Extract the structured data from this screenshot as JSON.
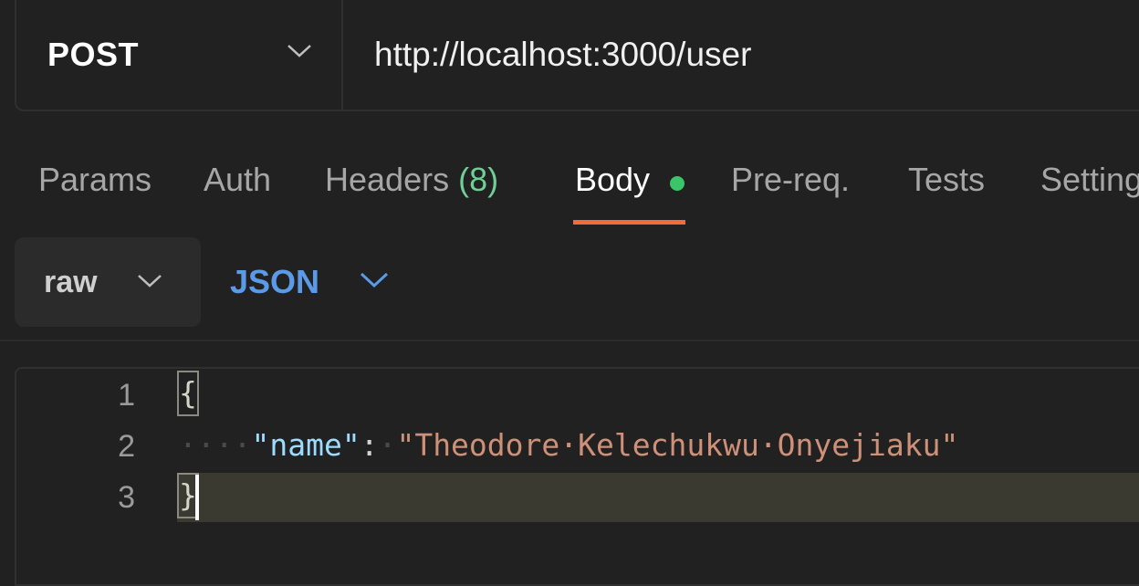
{
  "request": {
    "method": "POST",
    "url": "http://localhost:3000/user"
  },
  "tabs": {
    "params": "Params",
    "auth": "Auth",
    "headers": "Headers",
    "headers_count": "(8)",
    "body": "Body",
    "prereq": "Pre-req.",
    "tests": "Tests",
    "settings": "Settings"
  },
  "body_options": {
    "mode": "raw",
    "language": "JSON"
  },
  "editor": {
    "line_numbers": [
      "1",
      "2",
      "3"
    ],
    "open_brace": "{",
    "indent": "····",
    "key": "\"name\"",
    "colon": ":",
    "value": "\"Theodore·Kelechukwu·Onyejiaku\"",
    "close_brace": "}"
  },
  "colors": {
    "accent_underline": "#f26b3a",
    "body_dot": "#3ac569",
    "json_label": "#5b9ae6"
  }
}
